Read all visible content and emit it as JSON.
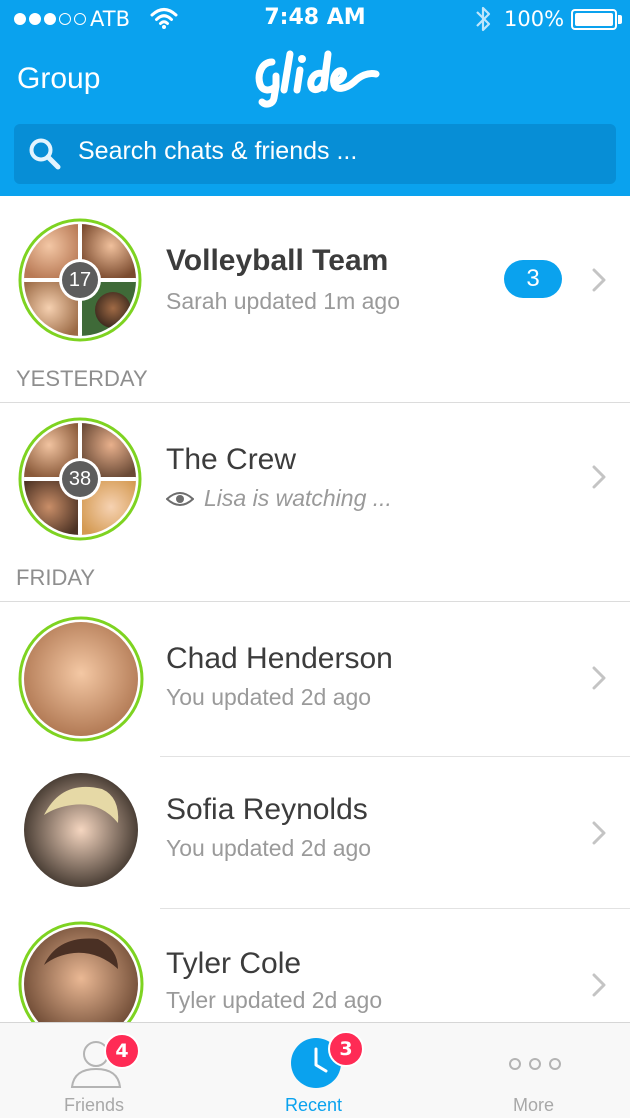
{
  "status_bar": {
    "carrier": "ATB",
    "time": "7:48 AM",
    "battery": "100%",
    "signal_bars_filled": 3,
    "signal_bars_total": 5
  },
  "nav": {
    "left_label": "Group",
    "logo_text": "Glide"
  },
  "search": {
    "placeholder": "Search chats & friends ..."
  },
  "sections": {
    "yesterday": "YESTERDAY",
    "friday": "FRIDAY"
  },
  "chats": [
    {
      "title": "Volleyball Team",
      "subtitle": "Sarah updated 1m ago",
      "member_count": "17",
      "unread": "3"
    },
    {
      "title": "The Crew",
      "subtitle": "Lisa is watching ...",
      "member_count": "38"
    },
    {
      "title": "Chad Henderson",
      "subtitle": "You updated 2d ago"
    },
    {
      "title": "Sofia Reynolds",
      "subtitle": "You updated 2d ago"
    },
    {
      "title": "Tyler Cole",
      "subtitle": "Tyler updated 2d ago"
    }
  ],
  "tabbar": {
    "friends": {
      "label": "Friends",
      "badge": "4"
    },
    "recent": {
      "label": "Recent",
      "badge": "3"
    },
    "more": {
      "label": "More"
    }
  },
  "colors": {
    "brand": "#0aa2ee",
    "active_ring": "#7ed321",
    "badge": "#ff2b55"
  }
}
